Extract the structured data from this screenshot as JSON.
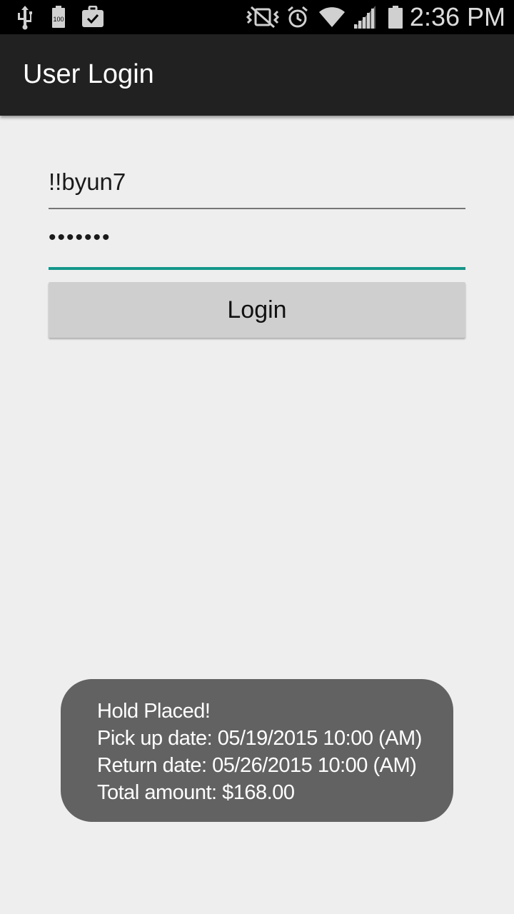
{
  "status_bar": {
    "time": "2:36 PM",
    "battery_label": "100",
    "icons": [
      "usb-icon",
      "battery-full-icon",
      "task-check-icon",
      "vibrate-icon",
      "alarm-icon",
      "wifi-icon",
      "signal-icon",
      "battery-icon"
    ]
  },
  "app_bar": {
    "title": "User Login"
  },
  "form": {
    "username_value": "!!byun7",
    "password_value": "•••••••",
    "login_label": "Login",
    "accent_color": "#13968a"
  },
  "toast": {
    "lines": [
      "Hold Placed!",
      "Pick up date: 05/19/2015 10:00 (AM)",
      "Return date: 05/26/2015 10:00 (AM)",
      "Total amount: $168.00"
    ]
  }
}
